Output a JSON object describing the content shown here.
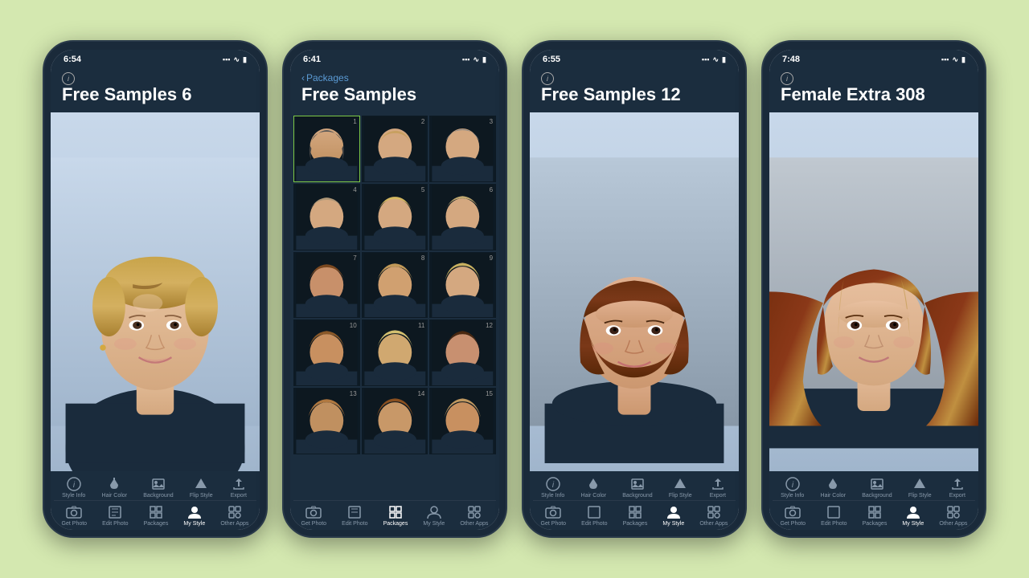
{
  "background_color": "#d4e8b0",
  "phones": [
    {
      "id": "phone1",
      "status_time": "6:54",
      "status_icons": [
        "signal",
        "wifi",
        "battery"
      ],
      "has_back": false,
      "back_label": "",
      "title": "Free Samples 6",
      "view": "portrait",
      "portrait_desc": "Blonde woman with short pixie cut, dark navy top",
      "active_tab_top": "",
      "active_tab_bottom": "My Style",
      "toolbar_top": [
        {
          "id": "style-info",
          "label": "Style Info",
          "icon": "info"
        },
        {
          "id": "hair-color",
          "label": "Hair Color",
          "icon": "bucket"
        },
        {
          "id": "background",
          "label": "Background",
          "icon": "photo"
        },
        {
          "id": "flip-style",
          "label": "Flip Style",
          "icon": "triangle"
        },
        {
          "id": "export",
          "label": "Export",
          "icon": "share"
        }
      ],
      "toolbar_bottom": [
        {
          "id": "get-photo",
          "label": "Get Photo",
          "icon": "camera",
          "active": false
        },
        {
          "id": "edit-photo",
          "label": "Edit Photo",
          "icon": "edit",
          "active": false
        },
        {
          "id": "packages",
          "label": "Packages",
          "icon": "grid",
          "active": false
        },
        {
          "id": "my-style",
          "label": "My Style",
          "icon": "person",
          "active": true
        },
        {
          "id": "other-apps",
          "label": "Other Apps",
          "icon": "apps",
          "active": false
        }
      ]
    },
    {
      "id": "phone2",
      "status_time": "6:41",
      "status_icons": [
        "signal",
        "wifi",
        "battery"
      ],
      "has_back": true,
      "back_label": "Packages",
      "title": "Free Samples",
      "view": "grid",
      "grid_count": 15,
      "selected_item": 1,
      "active_tab_bottom": "Packages",
      "toolbar_top": [],
      "toolbar_bottom": [
        {
          "id": "get-photo",
          "label": "Get Photo",
          "icon": "camera",
          "active": false
        },
        {
          "id": "edit-photo",
          "label": "Edit Photo",
          "icon": "edit",
          "active": false
        },
        {
          "id": "packages",
          "label": "Packages",
          "icon": "grid",
          "active": true
        },
        {
          "id": "my-style",
          "label": "My Style",
          "icon": "person",
          "active": false
        },
        {
          "id": "other-apps",
          "label": "Other Apps",
          "icon": "apps",
          "active": false
        }
      ]
    },
    {
      "id": "phone3",
      "status_time": "6:55",
      "status_icons": [
        "signal",
        "wifi",
        "battery"
      ],
      "has_back": false,
      "back_label": "",
      "title": "Free Samples 12",
      "view": "portrait",
      "portrait_desc": "Brunette woman with bob cut with bangs, dark top",
      "active_tab_bottom": "My Style",
      "toolbar_top": [
        {
          "id": "style-info",
          "label": "Style Info",
          "icon": "info"
        },
        {
          "id": "hair-color",
          "label": "Hair Color",
          "icon": "bucket"
        },
        {
          "id": "background",
          "label": "Background",
          "icon": "photo"
        },
        {
          "id": "flip-style",
          "label": "Flip Style",
          "icon": "triangle"
        },
        {
          "id": "export",
          "label": "Export",
          "icon": "share"
        }
      ],
      "toolbar_bottom": [
        {
          "id": "get-photo",
          "label": "Get Photo",
          "icon": "camera",
          "active": false
        },
        {
          "id": "edit-photo",
          "label": "Edit Photo",
          "icon": "edit",
          "active": false
        },
        {
          "id": "packages",
          "label": "Packages",
          "icon": "grid",
          "active": false
        },
        {
          "id": "my-style",
          "label": "My Style",
          "icon": "person",
          "active": true
        },
        {
          "id": "other-apps",
          "label": "Other Apps",
          "icon": "apps",
          "active": false
        }
      ]
    },
    {
      "id": "phone4",
      "status_time": "7:48",
      "status_icons": [
        "signal",
        "wifi",
        "battery"
      ],
      "has_back": false,
      "back_label": "",
      "title": "Female Extra 308",
      "view": "portrait",
      "portrait_desc": "Brunette woman with long layered hair, dark top",
      "active_tab_bottom": "My Style",
      "toolbar_top": [
        {
          "id": "style-info",
          "label": "Style Info",
          "icon": "info"
        },
        {
          "id": "hair-color",
          "label": "Hair Color",
          "icon": "bucket"
        },
        {
          "id": "background",
          "label": "Background",
          "icon": "photo"
        },
        {
          "id": "flip-style",
          "label": "Flip Style",
          "icon": "triangle"
        },
        {
          "id": "export",
          "label": "Export",
          "icon": "share"
        }
      ],
      "toolbar_bottom": [
        {
          "id": "get-photo",
          "label": "Get Photo",
          "icon": "camera",
          "active": false
        },
        {
          "id": "edit-photo",
          "label": "Edit Photo",
          "icon": "edit",
          "active": false
        },
        {
          "id": "packages",
          "label": "Packages",
          "icon": "grid",
          "active": false
        },
        {
          "id": "my-style",
          "label": "My Style",
          "icon": "person",
          "active": true
        },
        {
          "id": "other-apps",
          "label": "Other Apps",
          "icon": "apps",
          "active": false
        }
      ]
    }
  ],
  "toolbar_icons": {
    "info": "ℹ",
    "bucket": "🪣",
    "photo": "🖼",
    "triangle": "▲",
    "share": "↗",
    "camera": "📷",
    "edit": "⊞",
    "grid": "⊟",
    "person": "👤",
    "apps": "⊡"
  }
}
